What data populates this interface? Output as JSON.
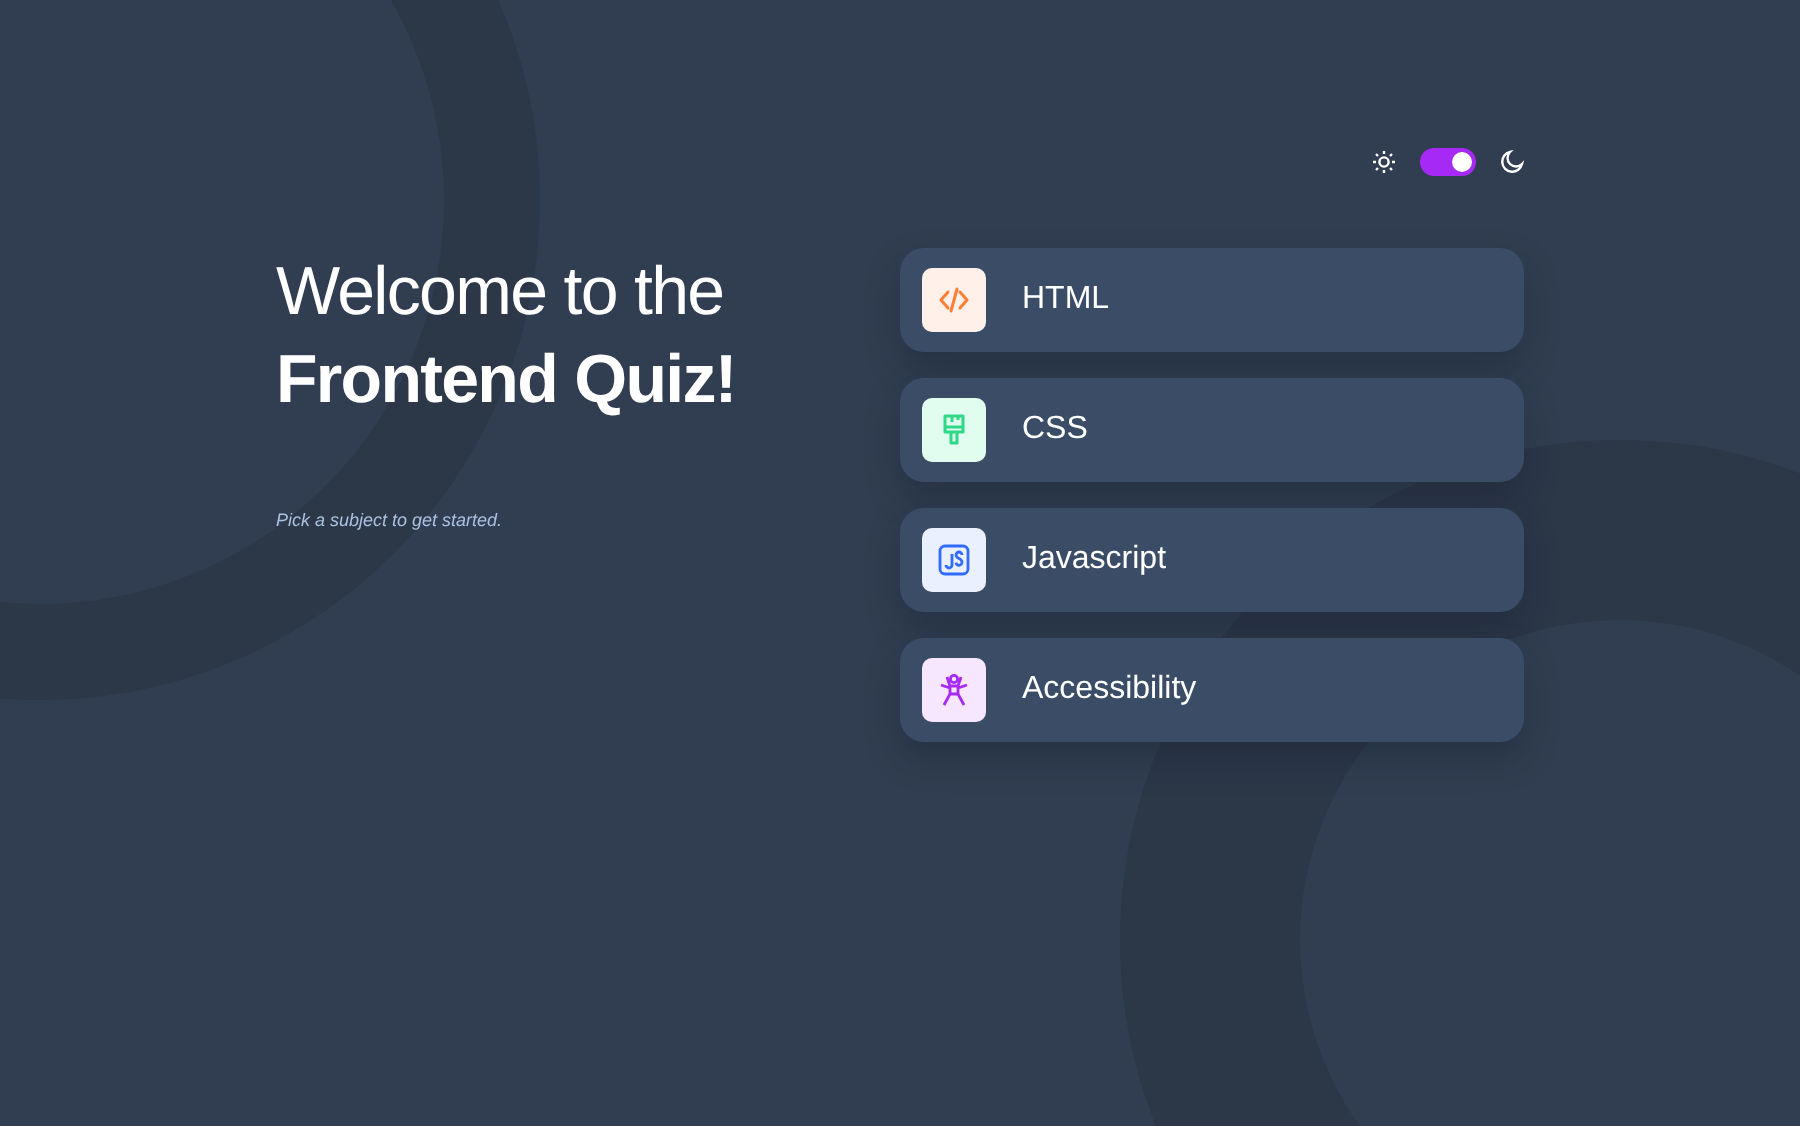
{
  "theme_toggle": {
    "dark_mode": true
  },
  "heading": {
    "line_1": "Welcome to the",
    "line_2": "Frontend Quiz!"
  },
  "subtitle": "Pick a subject to get started.",
  "subjects": [
    {
      "kind": "html",
      "label": "HTML"
    },
    {
      "kind": "css",
      "label": "CSS"
    },
    {
      "kind": "javascript",
      "label": "Javascript"
    },
    {
      "kind": "accessibility",
      "label": "Accessibility"
    }
  ]
}
